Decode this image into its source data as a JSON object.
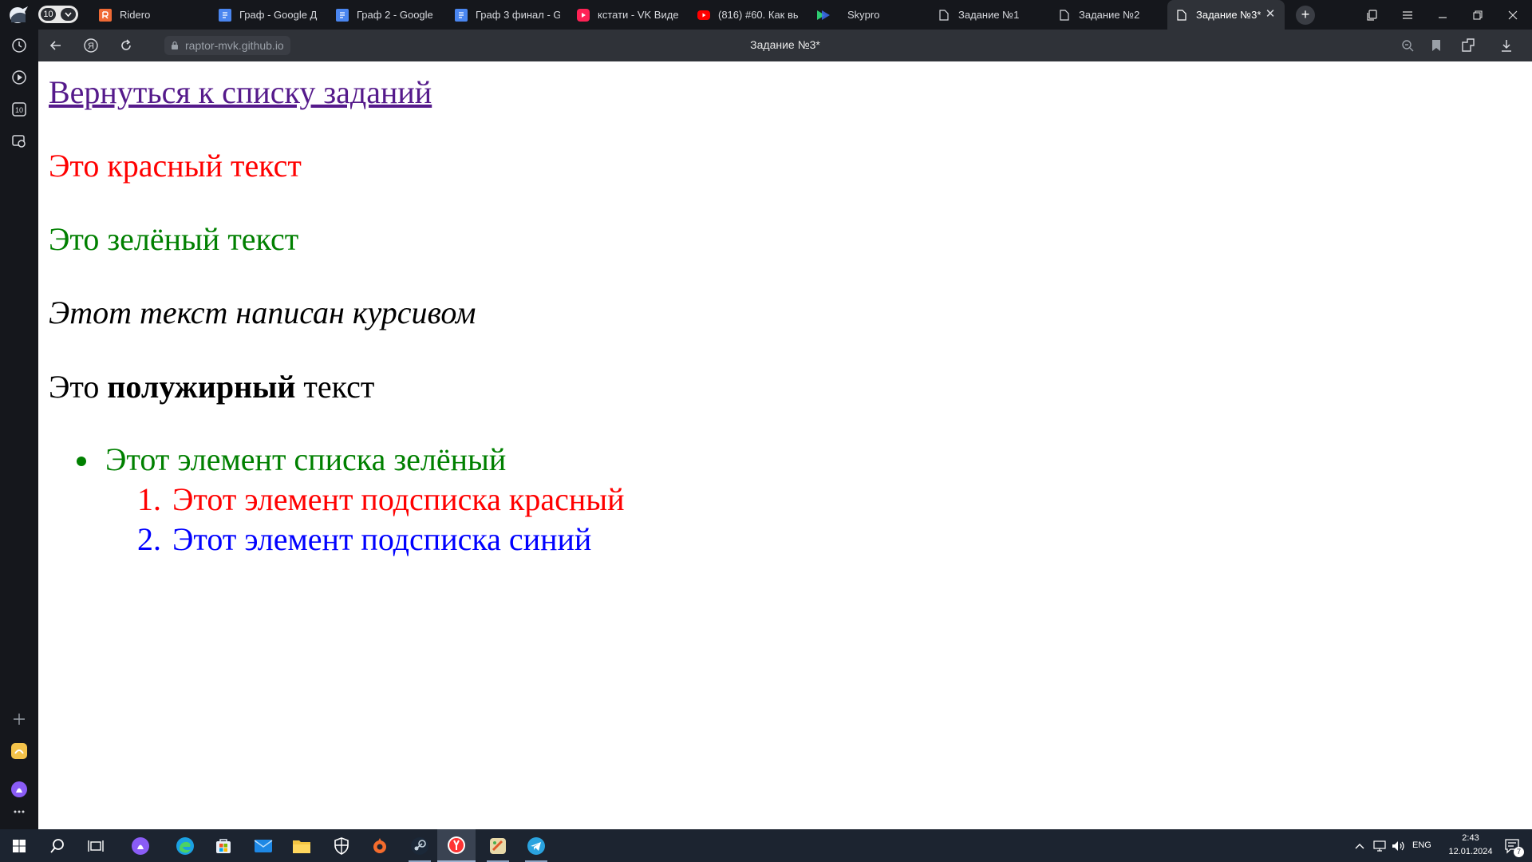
{
  "browser": {
    "tab_counter": "10",
    "tabs": [
      {
        "title": "Ridero",
        "favicon_color": "#f06a35"
      },
      {
        "title": "Граф - Google Д",
        "favicon_color": "#4a86f0"
      },
      {
        "title": "Граф 2 - Google",
        "favicon_color": "#4a86f0"
      },
      {
        "title": "Граф 3 финал - G",
        "favicon_color": "#4a86f0"
      },
      {
        "title": "кстати - VK Виде",
        "favicon_color": "#ff2255"
      },
      {
        "title": "(816) #60. Как вы",
        "favicon_color": "#ff0000"
      },
      {
        "title": "Skypro",
        "favicon_color": "#2ecc71"
      },
      {
        "title": "Задание №1",
        "favicon_color": "#d6d8dd"
      },
      {
        "title": "Задание №2",
        "favicon_color": "#d6d8dd"
      },
      {
        "title": "Задание №3*",
        "favicon_color": "#d6d8dd",
        "active": true
      }
    ],
    "new_tab_label": "+",
    "address": {
      "url": "raptor-mvk.github.io",
      "page_title": "Задание №3*"
    }
  },
  "page": {
    "back_link": "Вернуться к списку заданий",
    "red_text": "Это красный текст",
    "green_text": "Это зелёный текст",
    "italic_text": "Этот текст написан курсивом",
    "bold_line": {
      "before": "Это ",
      "bold": "полужирный",
      "after": " текст"
    },
    "list": {
      "item": "Этот элемент списка зелёный",
      "subitems": [
        {
          "marker": "1.",
          "text": "Этот элемент подсписка красный"
        },
        {
          "marker": "2.",
          "text": "Этот элемент подсписка синий"
        }
      ]
    },
    "colors": {
      "link": "#551a8b",
      "red": "#ff0000",
      "green": "#008000",
      "blue": "#0000ff"
    }
  },
  "taskbar": {
    "language": "ENG",
    "time": "2:43",
    "date": "12.01.2024",
    "notifications": "7"
  }
}
